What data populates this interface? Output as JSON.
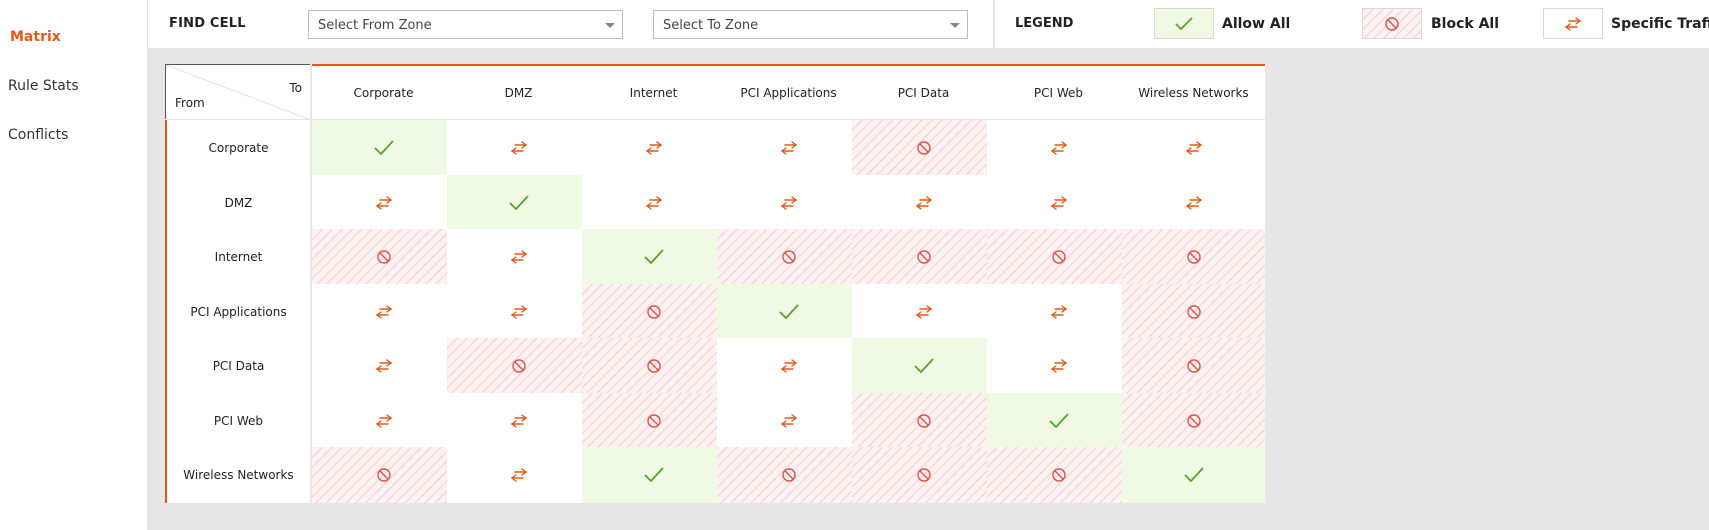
{
  "sidebar": {
    "items": [
      {
        "label": "Matrix",
        "active": true
      },
      {
        "label": "Rule Stats",
        "active": false
      },
      {
        "label": "Conflicts",
        "active": false
      }
    ]
  },
  "find_cell": {
    "title": "FIND CELL",
    "from_placeholder": "Select From Zone",
    "to_placeholder": "Select To Zone"
  },
  "legend": {
    "title": "LEGEND",
    "allow_label": "Allow All",
    "block_label": "Block All",
    "specific_label": "Specific Traffic"
  },
  "matrix": {
    "corner_to": "To",
    "corner_from": "From",
    "zones": [
      "Corporate",
      "DMZ",
      "Internet",
      "PCI Applications",
      "PCI Data",
      "PCI Web",
      "Wireless Networks"
    ],
    "cells": [
      [
        "allow",
        "specific",
        "specific",
        "specific",
        "block",
        "specific",
        "specific"
      ],
      [
        "specific",
        "allow",
        "specific",
        "specific",
        "specific",
        "specific",
        "specific"
      ],
      [
        "block",
        "specific",
        "allow",
        "block",
        "block",
        "block",
        "block"
      ],
      [
        "specific",
        "specific",
        "block",
        "allow",
        "specific",
        "specific",
        "block"
      ],
      [
        "specific",
        "block",
        "block",
        "specific",
        "allow",
        "specific",
        "block"
      ],
      [
        "specific",
        "specific",
        "block",
        "specific",
        "block",
        "allow",
        "block"
      ],
      [
        "block",
        "specific",
        "allow",
        "block",
        "block",
        "block",
        "allow"
      ]
    ]
  },
  "icons": {
    "allow": "check-icon",
    "block": "block-icon",
    "specific": "bidirectional-arrows-icon"
  },
  "colors": {
    "accent": "#e05a1a",
    "allow_green": "#5aa02c",
    "block_red": "#d9534f"
  }
}
